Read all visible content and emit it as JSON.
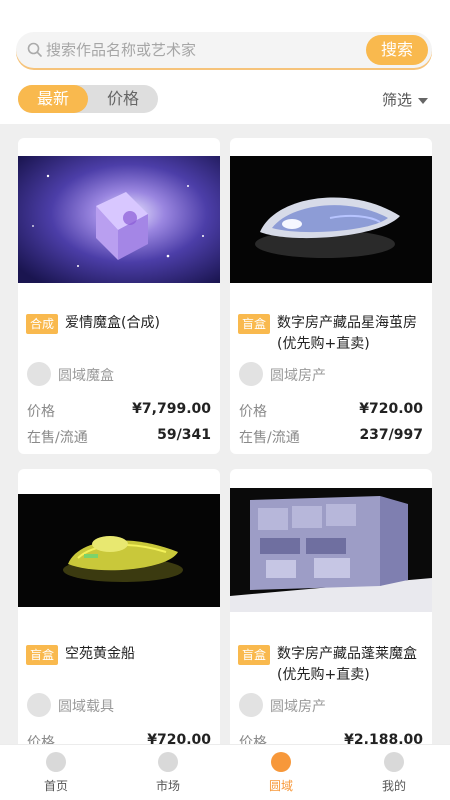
{
  "search": {
    "placeholder": "搜索作品名称或艺术家",
    "button_label": "搜索"
  },
  "tabs": {
    "latest": "最新",
    "price": "价格"
  },
  "filter": {
    "label": "筛选"
  },
  "cards": [
    {
      "tag": "合成",
      "title": "爱情魔盒(合成)",
      "creator": "圆域魔盒",
      "price_label": "价格",
      "price": "¥7,799.00",
      "stock_label": "在售/流通",
      "stock": "59/341"
    },
    {
      "tag": "盲盒",
      "title": "数字房产藏品星海茧房(优先购+直卖)",
      "creator": "圆域房产",
      "price_label": "价格",
      "price": "¥720.00",
      "stock_label": "在售/流通",
      "stock": "237/997"
    },
    {
      "tag": "盲盒",
      "title": "空苑黄金船",
      "creator": "圆域载具",
      "price_label": "价格",
      "price": "¥720.00"
    },
    {
      "tag": "盲盒",
      "title": "数字房产藏品蓬莱魔盒(优先购+直卖)",
      "creator": "圆域房产",
      "price_label": "价格",
      "price": "¥2,188.00"
    }
  ],
  "nav": [
    {
      "label": "首页",
      "icon": "home-icon"
    },
    {
      "label": "市场",
      "icon": "market-icon"
    },
    {
      "label": "圆域",
      "icon": "sphere-icon",
      "active": true
    },
    {
      "label": "我的",
      "icon": "profile-icon"
    }
  ],
  "colors": {
    "accent": "#f9b94e",
    "active_nav": "#f7983a"
  }
}
